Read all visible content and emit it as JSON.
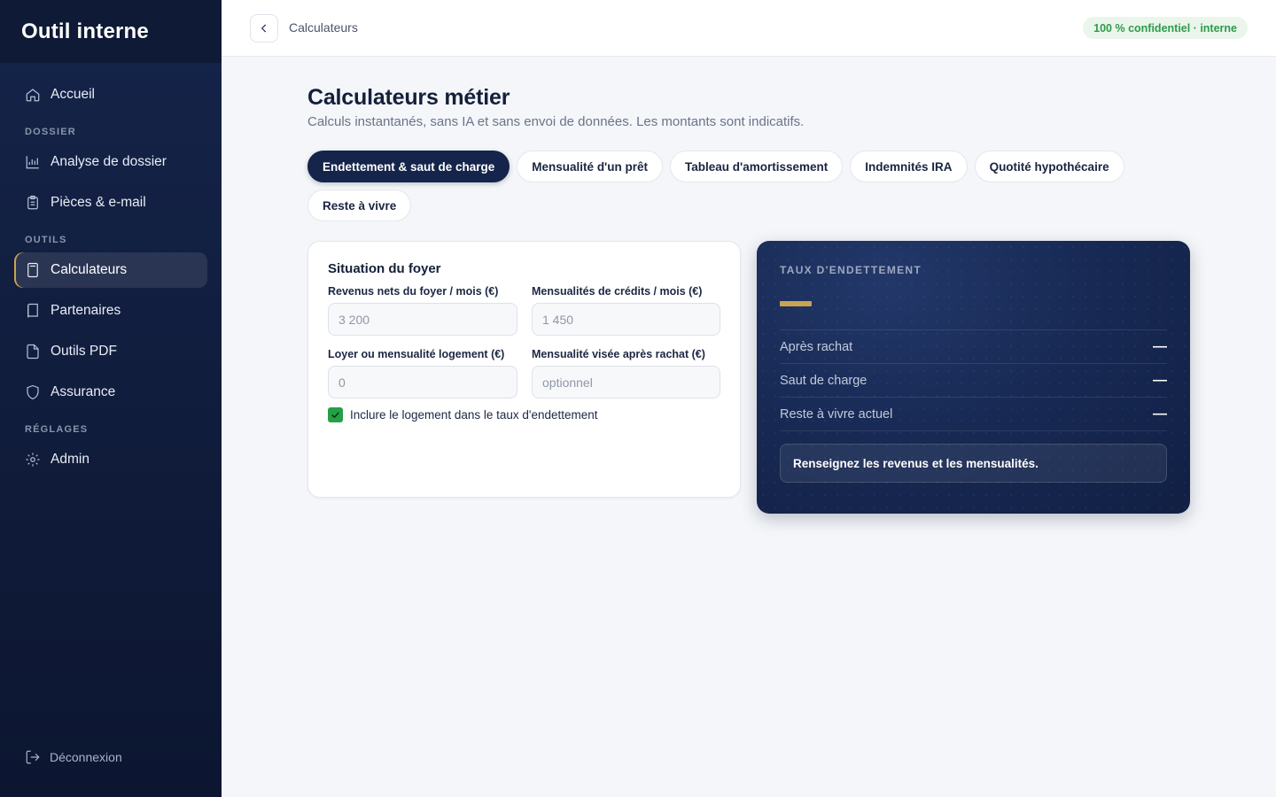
{
  "app": {
    "title": "Outil interne"
  },
  "sidebar": {
    "items": [
      {
        "label": "Accueil",
        "icon": "home-icon"
      },
      {
        "section": "DOSSIER"
      },
      {
        "label": "Analyse de dossier",
        "icon": "bar-chart-icon"
      },
      {
        "label": "Pièces & e-mail",
        "icon": "clipboard-icon"
      },
      {
        "section": "OUTILS"
      },
      {
        "label": "Calculateurs",
        "icon": "calculator-icon",
        "active": true
      },
      {
        "label": "Partenaires",
        "icon": "book-icon"
      },
      {
        "label": "Outils PDF",
        "icon": "file-icon"
      },
      {
        "label": "Assurance",
        "icon": "shield-icon"
      },
      {
        "section": "RÉGLAGES"
      },
      {
        "label": "Admin",
        "icon": "gear-icon"
      }
    ],
    "logout_label": "Déconnexion"
  },
  "header": {
    "breadcrumb": "Calculateurs",
    "badge": "100 % confidentiel · interne",
    "badge_color": "#2f9a4a"
  },
  "page": {
    "title": "Calculateurs métier",
    "subtitle": "Calculs instantanés, sans IA et sans envoi de données. Les montants sont indicatifs."
  },
  "tabs": [
    {
      "label": "Endettement & saut de charge",
      "active": true
    },
    {
      "label": "Mensualité d'un prêt"
    },
    {
      "label": "Tableau d'amortissement"
    },
    {
      "label": "Indemnités IRA"
    },
    {
      "label": "Quotité hypothécaire"
    },
    {
      "label": "Reste à vivre"
    }
  ],
  "form": {
    "title": "Situation du foyer",
    "fields": {
      "revenus": {
        "label": "Revenus nets du foyer / mois (€)",
        "value": "",
        "placeholder": "3 200"
      },
      "mensualites": {
        "label": "Mensualités de crédits / mois (€)",
        "value": "",
        "placeholder": "1 450"
      },
      "loyer": {
        "label": "Loyer ou mensualité logement (€)",
        "value": "",
        "placeholder": "0"
      },
      "visee": {
        "label": "Mensualité visée après rachat (€)",
        "value": "",
        "placeholder": "optionnel"
      }
    },
    "include_housing": {
      "label": "Inclure le logement dans le taux d'endettement",
      "checked": true
    }
  },
  "result": {
    "label": "TAUX D'ENDETTEMENT",
    "accent_color": "#c9a34f",
    "rows": [
      {
        "label": "Après rachat",
        "value": "—"
      },
      {
        "label": "Saut de charge",
        "value": "—"
      },
      {
        "label": "Reste à vivre actuel",
        "value": "—"
      }
    ],
    "note": "Renseignez les revenus et les mensualités."
  }
}
